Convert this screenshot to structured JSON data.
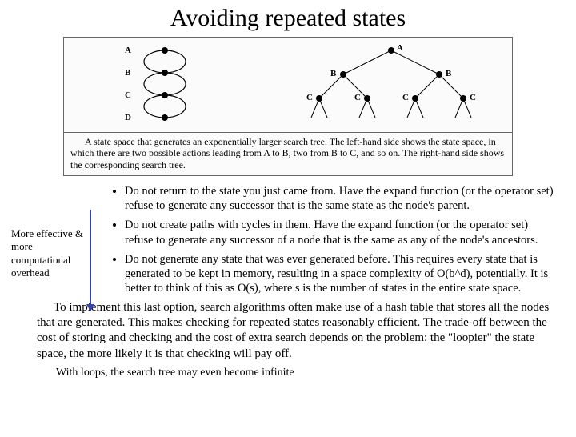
{
  "title": "Avoiding repeated states",
  "figure": {
    "labels": {
      "A": "A",
      "B": "B",
      "C": "C",
      "D": "D"
    },
    "caption": "A state space that generates an exponentially larger search tree. The left-hand side shows the state space, in which there are two possible actions leading from A to B, two from B to C, and so on. The right-hand side shows the corresponding search tree."
  },
  "side_note": "More effective & more computational overhead",
  "bullets": [
    "Do not return to the state you just came from. Have the expand function (or the operator set) refuse to generate any successor that is the same state as the node's parent.",
    "Do not create paths with cycles in them. Have the expand function (or the operator set) refuse to generate any successor of a node that is the same as any of the node's ancestors.",
    "Do not generate any state that was ever generated before. This requires every state that is generated to be kept in memory, resulting in a space complexity of O(b^d), potentially. It is better to think of this as O(s), where s is the number of states in the entire state space."
  ],
  "paragraph": "To implement this last option, search algorithms often make use of a hash table that stores all the nodes that are generated. This makes checking for repeated states reasonably efficient. The trade-off between the cost of storing and checking and the cost of extra search depends on the problem: the \"loopier\" the state space, the more likely it is that checking will pay off.",
  "footnote": "With loops, the search tree may even become infinite"
}
